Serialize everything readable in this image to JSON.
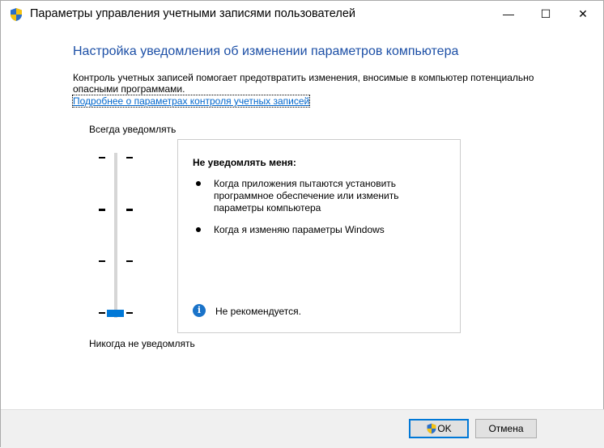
{
  "window": {
    "title": "Параметры управления учетными записями пользователей",
    "minimize": "—",
    "maximize": "☐",
    "close": "✕"
  },
  "heading": "Настройка уведомления об изменении параметров компьютера",
  "description": "Контроль учетных записей помогает предотвратить изменения, вносимые в компьютер потенциально опасными программами.",
  "link": "Подробнее о параметрах контроля учетных записей",
  "slider": {
    "top_label": "Всегда уведомлять",
    "bottom_label": "Никогда не уведомлять",
    "levels": 4,
    "selected_level": 0
  },
  "panel": {
    "title": "Не уведомлять меня:",
    "bullets": [
      "Когда приложения пытаются установить программное обеспечение или изменить параметры компьютера",
      "Когда я изменяю параметры Windows"
    ],
    "note": "Не рекомендуется."
  },
  "buttons": {
    "ok": "OK",
    "cancel": "Отмена"
  },
  "colors": {
    "accent": "#0078d7",
    "heading": "#1c4fa6"
  }
}
